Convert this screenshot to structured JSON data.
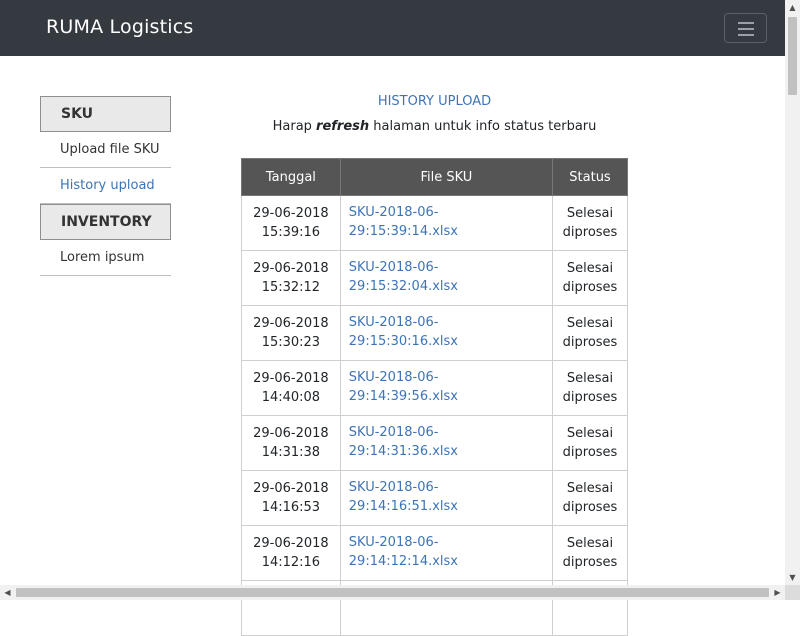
{
  "navbar": {
    "brand": "RUMA Logistics",
    "toggle_icon": "hamburger-menu-icon"
  },
  "sidebar": {
    "sections": [
      {
        "header": "SKU",
        "items": [
          {
            "label": "Upload file SKU",
            "active": false
          },
          {
            "label": "History upload",
            "active": true
          }
        ]
      },
      {
        "header": "INVENTORY",
        "items": [
          {
            "label": "Lorem ipsum",
            "active": false
          }
        ]
      }
    ]
  },
  "main": {
    "title": "HISTORY UPLOAD",
    "subtitle_before": "Harap ",
    "subtitle_emphasis": "refresh",
    "subtitle_after": " halaman untuk info status terbaru",
    "table": {
      "headers": [
        "Tanggal",
        "File SKU",
        "Status"
      ],
      "rows": [
        {
          "date": "29-06-2018",
          "time": "15:39:16",
          "file": "SKU-2018-06-29:15:39:14.xlsx",
          "status_1": "Selesai",
          "status_2": "diproses"
        },
        {
          "date": "29-06-2018",
          "time": "15:32:12",
          "file": "SKU-2018-06-29:15:32:04.xlsx",
          "status_1": "Selesai",
          "status_2": "diproses"
        },
        {
          "date": "29-06-2018",
          "time": "15:30:23",
          "file": "SKU-2018-06-29:15:30:16.xlsx",
          "status_1": "Selesai",
          "status_2": "diproses"
        },
        {
          "date": "29-06-2018",
          "time": "14:40:08",
          "file": "SKU-2018-06-29:14:39:56.xlsx",
          "status_1": "Selesai",
          "status_2": "diproses"
        },
        {
          "date": "29-06-2018",
          "time": "14:31:38",
          "file": "SKU-2018-06-29:14:31:36.xlsx",
          "status_1": "Selesai",
          "status_2": "diproses"
        },
        {
          "date": "29-06-2018",
          "time": "14:16:53",
          "file": "SKU-2018-06-29:14:16:51.xlsx",
          "status_1": "Selesai",
          "status_2": "diproses"
        },
        {
          "date": "29-06-2018",
          "time": "14:12:16",
          "file": "SKU-2018-06-29:14:12:14.xlsx",
          "status_1": "Selesai",
          "status_2": "diproses"
        }
      ]
    }
  },
  "colors": {
    "navbar_bg": "#343a40",
    "accent_link": "#3d74b8",
    "table_header_bg": "#555555"
  }
}
